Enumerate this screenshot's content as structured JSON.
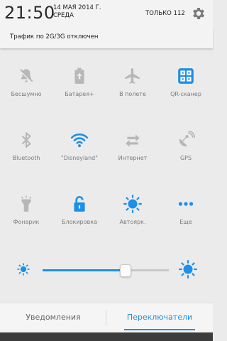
{
  "status_bar": {
    "time": "21:50",
    "date": "14 МАЯ 2014 Г.",
    "weekday": "СРЕДА",
    "network": "ТОЛЬКО 112",
    "settings_icon": "gear-icon"
  },
  "notice": {
    "text": "Трафик по 2G/3G отключен"
  },
  "toggles": [
    {
      "label": "Бесшумно",
      "icon": "bell-off-icon",
      "active": false
    },
    {
      "label": "Батарея+",
      "icon": "battery-plus-icon",
      "active": false
    },
    {
      "label": "В полете",
      "icon": "airplane-icon",
      "active": false
    },
    {
      "label": "QR-сканер",
      "icon": "qr-scanner-icon",
      "active": true
    },
    {
      "label": "Bluetooth",
      "icon": "bluetooth-icon",
      "active": false
    },
    {
      "label": "\"Disneyland\"",
      "icon": "wifi-icon",
      "active": true
    },
    {
      "label": "Интернет",
      "icon": "data-transfer-icon",
      "active": false
    },
    {
      "label": "GPS",
      "icon": "gps-icon",
      "active": false
    },
    {
      "label": "Фонарик",
      "icon": "flashlight-icon",
      "active": false
    },
    {
      "label": "Блокировка",
      "icon": "unlock-icon",
      "active": true
    },
    {
      "label": "Автоярк.",
      "icon": "auto-brightness-icon",
      "active": true
    },
    {
      "label": "Еще",
      "icon": "more-icon",
      "active": true
    }
  ],
  "brightness": {
    "level": 0.66,
    "low_icon": "brightness-low-icon",
    "high_icon": "brightness-high-icon"
  },
  "tabs": [
    {
      "label": "Уведомления",
      "active": false
    },
    {
      "label": "Переключатели",
      "active": true
    }
  ],
  "colors": {
    "accent": "#1d8fe9",
    "inactive_icon": "#b7b7b7",
    "label": "#7b7b7b"
  }
}
